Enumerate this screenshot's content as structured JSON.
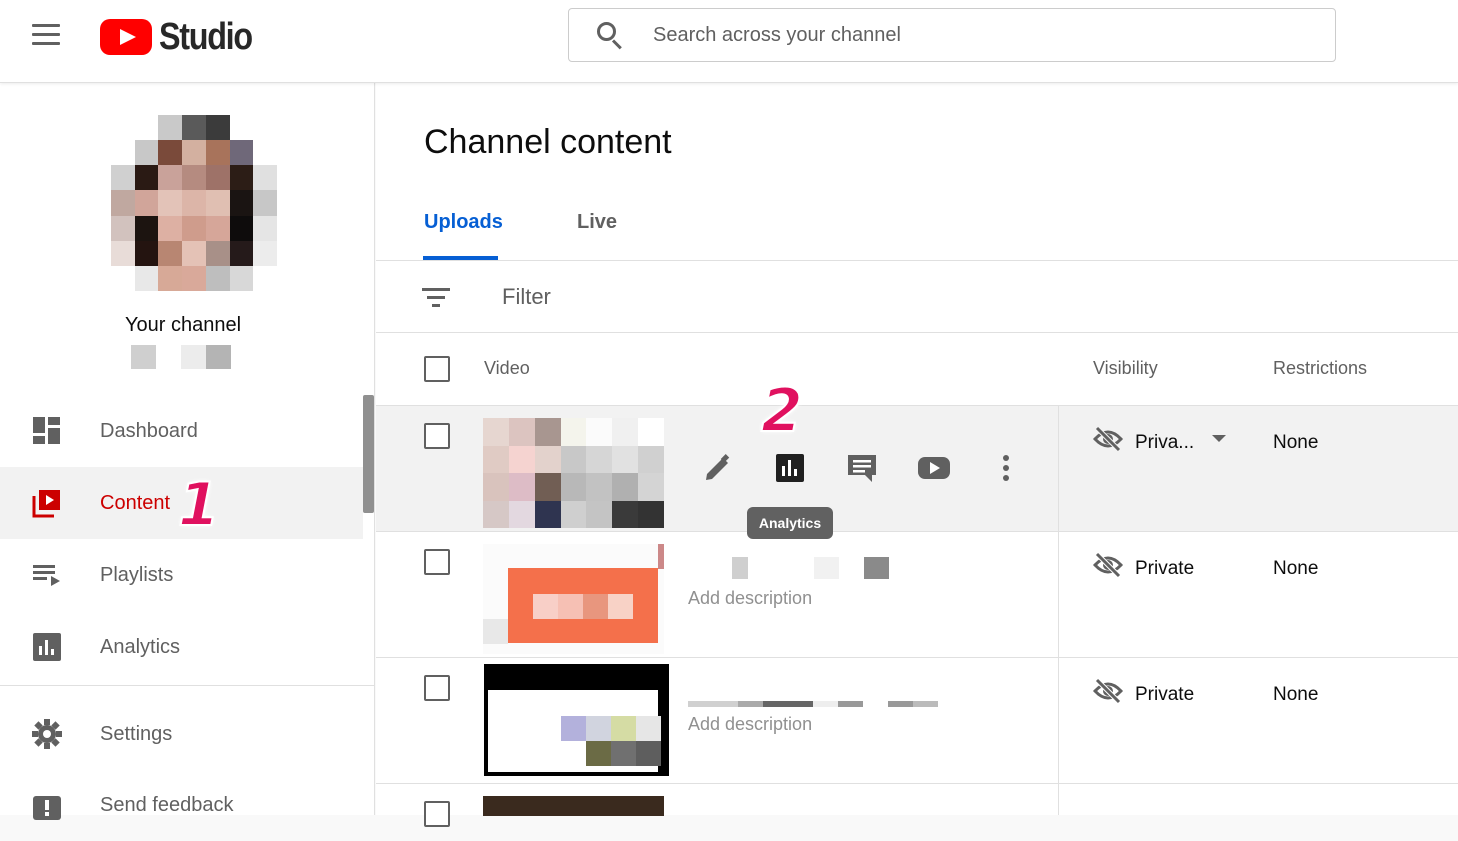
{
  "header": {
    "logo_text": "Studio",
    "search_placeholder": "Search across your channel"
  },
  "sidebar": {
    "channel_name": "Your channel",
    "items": [
      {
        "label": "Dashboard",
        "icon": "dashboard-icon"
      },
      {
        "label": "Content",
        "icon": "content-icon",
        "active": true
      },
      {
        "label": "Playlists",
        "icon": "playlists-icon"
      },
      {
        "label": "Analytics",
        "icon": "analytics-icon"
      },
      {
        "label": "Settings",
        "icon": "gear-icon"
      },
      {
        "label": "Send feedback",
        "icon": "feedback-icon"
      }
    ]
  },
  "annotations": {
    "step1": "1",
    "step2": "2"
  },
  "main": {
    "title": "Channel content",
    "tabs": [
      {
        "label": "Uploads",
        "active": true
      },
      {
        "label": "Live"
      }
    ],
    "filter_label": "Filter",
    "columns": {
      "video": "Video",
      "visibility": "Visibility",
      "restrictions": "Restrictions"
    },
    "tooltip": "Analytics",
    "rows": [
      {
        "visibility": "Priva...",
        "restrictions": "None",
        "description": ""
      },
      {
        "visibility": "Private",
        "restrictions": "None",
        "description": "Add description"
      },
      {
        "visibility": "Private",
        "restrictions": "None",
        "description": "Add description"
      }
    ]
  },
  "colors": {
    "accent_blue": "#065fd4",
    "active_red": "#cc0000",
    "annotation_pink": "#e0115f"
  }
}
